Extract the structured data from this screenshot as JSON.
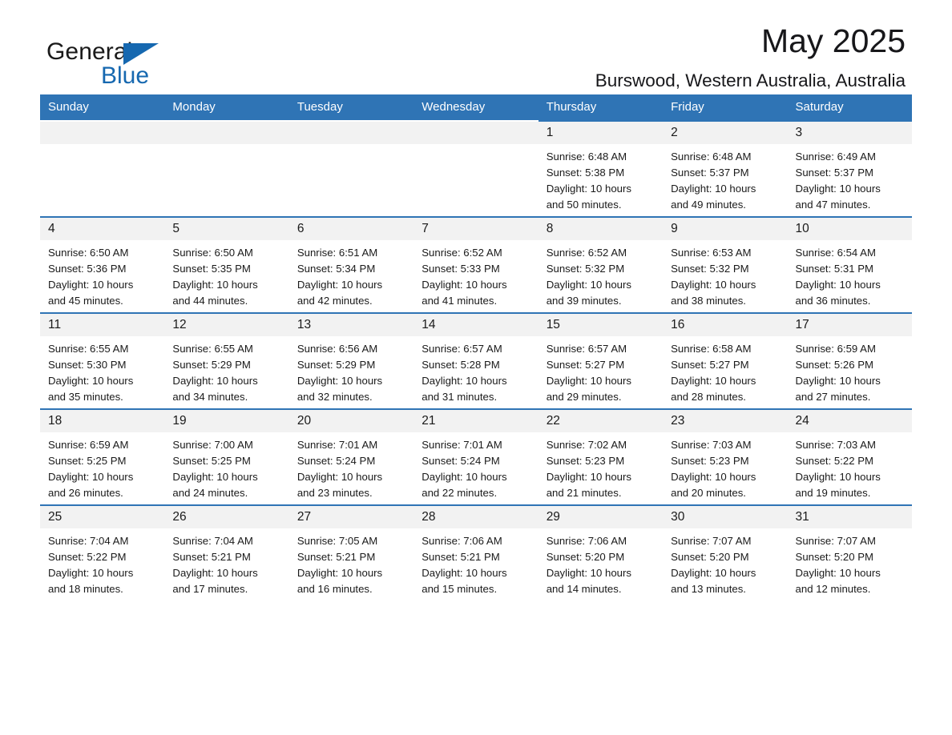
{
  "brand": {
    "name_part1": "General",
    "name_part2": "Blue",
    "accent_color": "#1668b0",
    "triangle_icon": "triangle-logo-icon"
  },
  "header": {
    "month_title": "May 2025",
    "location": "Burswood, Western Australia, Australia"
  },
  "calendar": {
    "header_bg": "#2f74b5",
    "daynum_bg": "#f2f2f2",
    "weekday_names": [
      "Sunday",
      "Monday",
      "Tuesday",
      "Wednesday",
      "Thursday",
      "Friday",
      "Saturday"
    ],
    "weeks": [
      [
        {
          "day": "",
          "sunrise": "",
          "sunset": "",
          "daylight1": "",
          "daylight2": ""
        },
        {
          "day": "",
          "sunrise": "",
          "sunset": "",
          "daylight1": "",
          "daylight2": ""
        },
        {
          "day": "",
          "sunrise": "",
          "sunset": "",
          "daylight1": "",
          "daylight2": ""
        },
        {
          "day": "",
          "sunrise": "",
          "sunset": "",
          "daylight1": "",
          "daylight2": ""
        },
        {
          "day": "1",
          "sunrise": "Sunrise: 6:48 AM",
          "sunset": "Sunset: 5:38 PM",
          "daylight1": "Daylight: 10 hours",
          "daylight2": "and 50 minutes."
        },
        {
          "day": "2",
          "sunrise": "Sunrise: 6:48 AM",
          "sunset": "Sunset: 5:37 PM",
          "daylight1": "Daylight: 10 hours",
          "daylight2": "and 49 minutes."
        },
        {
          "day": "3",
          "sunrise": "Sunrise: 6:49 AM",
          "sunset": "Sunset: 5:37 PM",
          "daylight1": "Daylight: 10 hours",
          "daylight2": "and 47 minutes."
        }
      ],
      [
        {
          "day": "4",
          "sunrise": "Sunrise: 6:50 AM",
          "sunset": "Sunset: 5:36 PM",
          "daylight1": "Daylight: 10 hours",
          "daylight2": "and 45 minutes."
        },
        {
          "day": "5",
          "sunrise": "Sunrise: 6:50 AM",
          "sunset": "Sunset: 5:35 PM",
          "daylight1": "Daylight: 10 hours",
          "daylight2": "and 44 minutes."
        },
        {
          "day": "6",
          "sunrise": "Sunrise: 6:51 AM",
          "sunset": "Sunset: 5:34 PM",
          "daylight1": "Daylight: 10 hours",
          "daylight2": "and 42 minutes."
        },
        {
          "day": "7",
          "sunrise": "Sunrise: 6:52 AM",
          "sunset": "Sunset: 5:33 PM",
          "daylight1": "Daylight: 10 hours",
          "daylight2": "and 41 minutes."
        },
        {
          "day": "8",
          "sunrise": "Sunrise: 6:52 AM",
          "sunset": "Sunset: 5:32 PM",
          "daylight1": "Daylight: 10 hours",
          "daylight2": "and 39 minutes."
        },
        {
          "day": "9",
          "sunrise": "Sunrise: 6:53 AM",
          "sunset": "Sunset: 5:32 PM",
          "daylight1": "Daylight: 10 hours",
          "daylight2": "and 38 minutes."
        },
        {
          "day": "10",
          "sunrise": "Sunrise: 6:54 AM",
          "sunset": "Sunset: 5:31 PM",
          "daylight1": "Daylight: 10 hours",
          "daylight2": "and 36 minutes."
        }
      ],
      [
        {
          "day": "11",
          "sunrise": "Sunrise: 6:55 AM",
          "sunset": "Sunset: 5:30 PM",
          "daylight1": "Daylight: 10 hours",
          "daylight2": "and 35 minutes."
        },
        {
          "day": "12",
          "sunrise": "Sunrise: 6:55 AM",
          "sunset": "Sunset: 5:29 PM",
          "daylight1": "Daylight: 10 hours",
          "daylight2": "and 34 minutes."
        },
        {
          "day": "13",
          "sunrise": "Sunrise: 6:56 AM",
          "sunset": "Sunset: 5:29 PM",
          "daylight1": "Daylight: 10 hours",
          "daylight2": "and 32 minutes."
        },
        {
          "day": "14",
          "sunrise": "Sunrise: 6:57 AM",
          "sunset": "Sunset: 5:28 PM",
          "daylight1": "Daylight: 10 hours",
          "daylight2": "and 31 minutes."
        },
        {
          "day": "15",
          "sunrise": "Sunrise: 6:57 AM",
          "sunset": "Sunset: 5:27 PM",
          "daylight1": "Daylight: 10 hours",
          "daylight2": "and 29 minutes."
        },
        {
          "day": "16",
          "sunrise": "Sunrise: 6:58 AM",
          "sunset": "Sunset: 5:27 PM",
          "daylight1": "Daylight: 10 hours",
          "daylight2": "and 28 minutes."
        },
        {
          "day": "17",
          "sunrise": "Sunrise: 6:59 AM",
          "sunset": "Sunset: 5:26 PM",
          "daylight1": "Daylight: 10 hours",
          "daylight2": "and 27 minutes."
        }
      ],
      [
        {
          "day": "18",
          "sunrise": "Sunrise: 6:59 AM",
          "sunset": "Sunset: 5:25 PM",
          "daylight1": "Daylight: 10 hours",
          "daylight2": "and 26 minutes."
        },
        {
          "day": "19",
          "sunrise": "Sunrise: 7:00 AM",
          "sunset": "Sunset: 5:25 PM",
          "daylight1": "Daylight: 10 hours",
          "daylight2": "and 24 minutes."
        },
        {
          "day": "20",
          "sunrise": "Sunrise: 7:01 AM",
          "sunset": "Sunset: 5:24 PM",
          "daylight1": "Daylight: 10 hours",
          "daylight2": "and 23 minutes."
        },
        {
          "day": "21",
          "sunrise": "Sunrise: 7:01 AM",
          "sunset": "Sunset: 5:24 PM",
          "daylight1": "Daylight: 10 hours",
          "daylight2": "and 22 minutes."
        },
        {
          "day": "22",
          "sunrise": "Sunrise: 7:02 AM",
          "sunset": "Sunset: 5:23 PM",
          "daylight1": "Daylight: 10 hours",
          "daylight2": "and 21 minutes."
        },
        {
          "day": "23",
          "sunrise": "Sunrise: 7:03 AM",
          "sunset": "Sunset: 5:23 PM",
          "daylight1": "Daylight: 10 hours",
          "daylight2": "and 20 minutes."
        },
        {
          "day": "24",
          "sunrise": "Sunrise: 7:03 AM",
          "sunset": "Sunset: 5:22 PM",
          "daylight1": "Daylight: 10 hours",
          "daylight2": "and 19 minutes."
        }
      ],
      [
        {
          "day": "25",
          "sunrise": "Sunrise: 7:04 AM",
          "sunset": "Sunset: 5:22 PM",
          "daylight1": "Daylight: 10 hours",
          "daylight2": "and 18 minutes."
        },
        {
          "day": "26",
          "sunrise": "Sunrise: 7:04 AM",
          "sunset": "Sunset: 5:21 PM",
          "daylight1": "Daylight: 10 hours",
          "daylight2": "and 17 minutes."
        },
        {
          "day": "27",
          "sunrise": "Sunrise: 7:05 AM",
          "sunset": "Sunset: 5:21 PM",
          "daylight1": "Daylight: 10 hours",
          "daylight2": "and 16 minutes."
        },
        {
          "day": "28",
          "sunrise": "Sunrise: 7:06 AM",
          "sunset": "Sunset: 5:21 PM",
          "daylight1": "Daylight: 10 hours",
          "daylight2": "and 15 minutes."
        },
        {
          "day": "29",
          "sunrise": "Sunrise: 7:06 AM",
          "sunset": "Sunset: 5:20 PM",
          "daylight1": "Daylight: 10 hours",
          "daylight2": "and 14 minutes."
        },
        {
          "day": "30",
          "sunrise": "Sunrise: 7:07 AM",
          "sunset": "Sunset: 5:20 PM",
          "daylight1": "Daylight: 10 hours",
          "daylight2": "and 13 minutes."
        },
        {
          "day": "31",
          "sunrise": "Sunrise: 7:07 AM",
          "sunset": "Sunset: 5:20 PM",
          "daylight1": "Daylight: 10 hours",
          "daylight2": "and 12 minutes."
        }
      ]
    ]
  }
}
